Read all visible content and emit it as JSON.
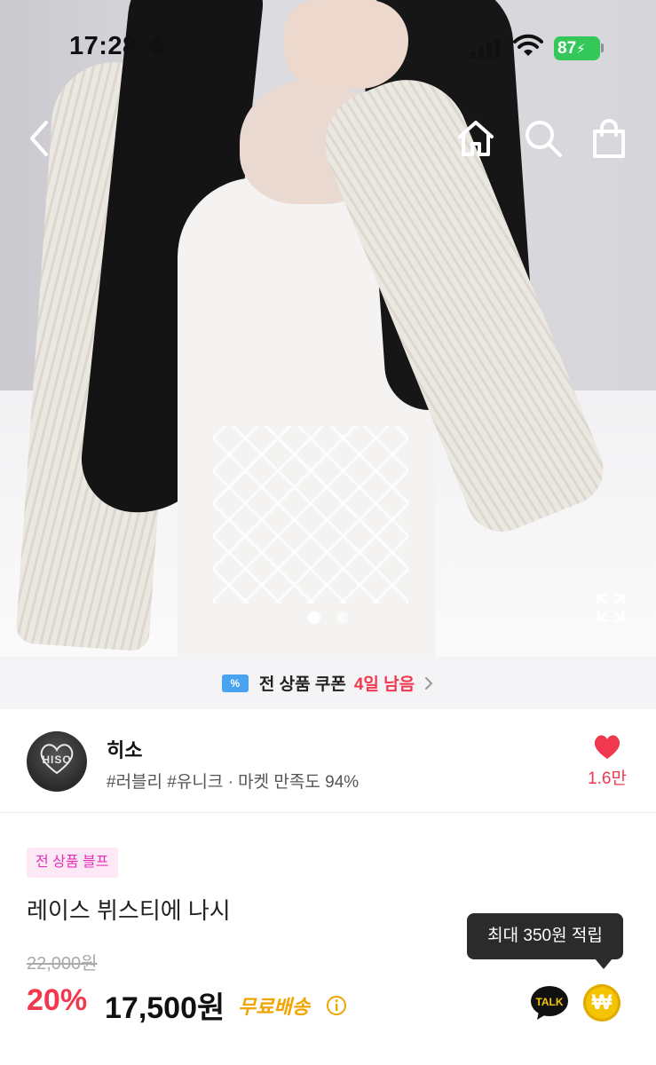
{
  "status_bar": {
    "time": "17:28",
    "battery": "87"
  },
  "hero": {
    "current_slide": 1,
    "total_slides": 2
  },
  "coupon_banner": {
    "label": "전 상품 쿠폰",
    "remaining": "4일 남음"
  },
  "shop": {
    "avatar_text": "HISO",
    "name": "히소",
    "tags": "#러블리 #유니크 · 마켓 만족도 94%",
    "like_count": "1.6만"
  },
  "product": {
    "badge": "전 상품 블프",
    "title": "레이스 뷔스티에 나시",
    "original_price": "22,000원",
    "discount": "20%",
    "price": "17,500원",
    "shipping": "무료배송"
  },
  "reward_tooltip": "최대 350원 적립",
  "talk_label": "TALK",
  "coin_symbol": "₩",
  "colors": {
    "accent": "#f0384f",
    "shipping": "#f0a500",
    "badge_text": "#e232b6",
    "battery": "#34c759",
    "coin": "#f5c400"
  }
}
